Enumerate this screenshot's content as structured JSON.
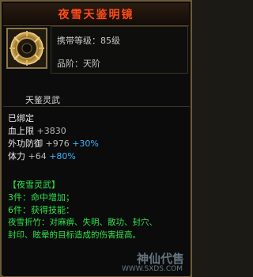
{
  "title": "夜雪天鉴明镜",
  "info": {
    "level_label": "携带等级：",
    "level_value": "85级",
    "rank_label": "品阶：",
    "rank_value": "天阶"
  },
  "icon_name": "天鉴灵武",
  "status": "已绑定",
  "stats": [
    {
      "label": "血上限",
      "value": "+3830",
      "pct": ""
    },
    {
      "label": "外功防御",
      "value": "+976",
      "pct": "+30%"
    },
    {
      "label": "体力",
      "value": "+64",
      "pct": "+80%"
    }
  ],
  "set": {
    "header": "【夜雪灵武】",
    "line1": "3件：命中增加；",
    "line2": "6件：获得技能：",
    "line3": "夜雪折竹：对麻痹、失明、散功、封穴、",
    "line4": "封印、眩晕的目标造成的伤害提高。"
  },
  "watermark": {
    "logo": "神仙代售",
    "url": "WWW.SXDS.COM"
  },
  "colors": {
    "title": "#ff4a1a",
    "set_text": "#2fe04a",
    "pct": "#3ab4ff"
  }
}
